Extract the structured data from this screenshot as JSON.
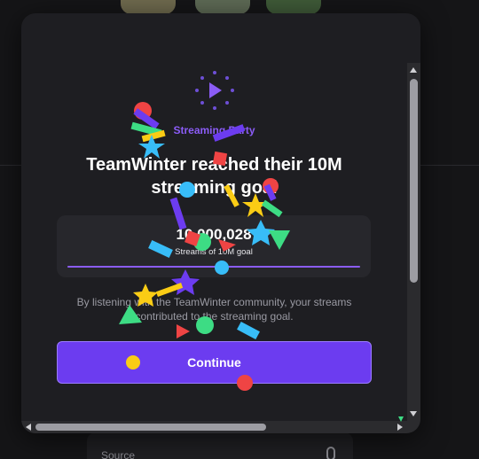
{
  "background": {
    "source_label": "Source"
  },
  "modal": {
    "party_label": "Streaming Party",
    "heading": "TeamWinter reached their 10M streaming goal",
    "goal": {
      "number": "10,000,028",
      "caption": "Streams of 10M goal",
      "progress": 1.0
    },
    "description": "By listening with the TeamWinter community, your streams contributed to the streaming goal.",
    "continue_label": "Continue"
  },
  "icons": {
    "loader": "play-loader-icon",
    "microphone": "microphone-icon"
  },
  "colors": {
    "accent": "#8b5cf6",
    "button": "#6c3cf0",
    "modal_bg": "#1e1e22",
    "card_bg": "#27272c"
  }
}
